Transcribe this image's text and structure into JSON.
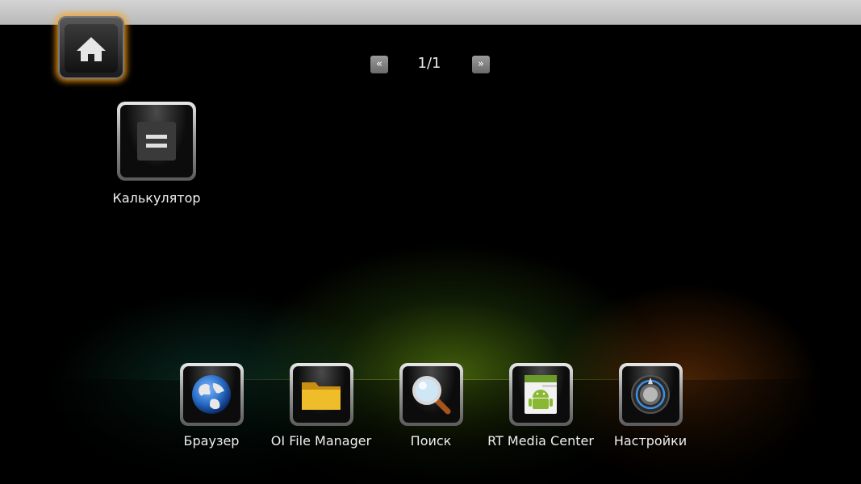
{
  "pager": {
    "prev_glyph": "«",
    "next_glyph": "»",
    "indicator": "1/1"
  },
  "home": {
    "icon": "home-icon"
  },
  "desktop_apps": [
    {
      "label": "Калькулятор",
      "icon": "calculator-icon"
    }
  ],
  "dock_apps": [
    {
      "label": "Браузер",
      "icon": "globe-icon"
    },
    {
      "label": "OI File Manager",
      "icon": "folder-icon"
    },
    {
      "label": "Поиск",
      "icon": "magnifier-icon"
    },
    {
      "label": "RT Media Center",
      "icon": "android-media-icon"
    },
    {
      "label": "Настройки",
      "icon": "settings-knob-icon"
    }
  ],
  "colors": {
    "highlight": "#ffa014",
    "folder": "#e8b21c",
    "globe": "#2a6fc8",
    "android": "#8ab833"
  }
}
